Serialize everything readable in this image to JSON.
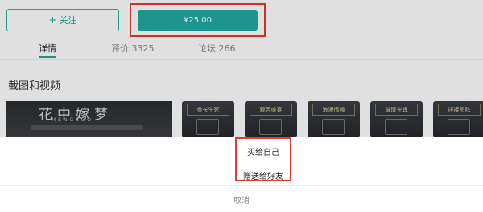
{
  "header": {
    "follow_label": "关注",
    "price_label": "¥25.00"
  },
  "tabs": [
    {
      "label": "详情",
      "active": true
    },
    {
      "label": "评价 3325",
      "active": false
    },
    {
      "label": "论坛 266",
      "active": false
    }
  ],
  "section": {
    "title": "截图和视频"
  },
  "screenshots": {
    "main_title": "花中嫁梦",
    "main_subtitle": "MENGSUO",
    "thumbs": [
      "参长生死",
      "观芳盛宴",
      "浪漫情缘",
      "璀璨光辉",
      "拼接图阵"
    ]
  },
  "action_sheet": {
    "options": [
      "买给自己",
      "赠送给好友"
    ],
    "cancel_label": "取消"
  },
  "colors": {
    "accent": "#23aaa0",
    "highlight_border": "#e53935"
  }
}
